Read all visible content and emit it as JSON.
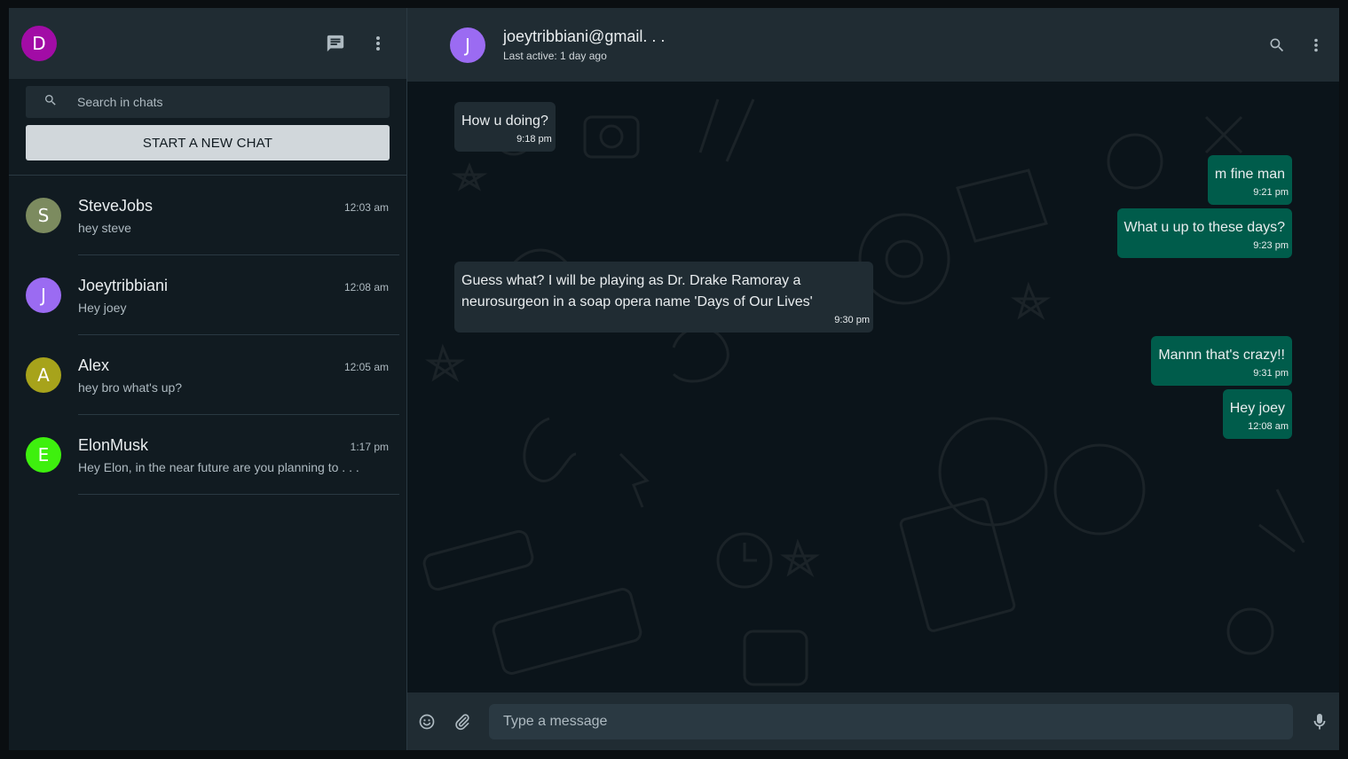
{
  "colors": {
    "accent_outgoing": "#005c4b",
    "incoming_bubble": "#202c33",
    "panel": "#202c33",
    "background": "#111b21"
  },
  "sidebar": {
    "user_avatar": {
      "initial": "D",
      "color": "#a20ca6"
    },
    "icons": [
      "chat-icon",
      "menu-dots-icon"
    ],
    "search": {
      "placeholder": "Search in chats",
      "value": ""
    },
    "new_chat_label": "START A NEW CHAT",
    "chats": [
      {
        "initial": "S",
        "color": "#7c8b5f",
        "name": "SteveJobs",
        "preview": "hey steve",
        "time": "12:03 am"
      },
      {
        "initial": "J",
        "color": "#9b6bf2",
        "name": "Joeytribbiani",
        "preview": "Hey joey",
        "time": "12:08 am"
      },
      {
        "initial": "A",
        "color": "#a7a31b",
        "name": "Alex",
        "preview": "hey bro what's up?",
        "time": "12:05 am"
      },
      {
        "initial": "E",
        "color": "#3ef00e",
        "name": "ElonMusk",
        "preview": "Hey Elon, in the near future are you planning to . . .",
        "time": "1:17 pm"
      }
    ]
  },
  "conversation": {
    "contact": {
      "initial": "J",
      "color": "#9b6bf2",
      "name": "joeytribbiani@gmail. . .",
      "status": "Last active: 1 day ago"
    },
    "icons": [
      "search-icon",
      "menu-dots-icon"
    ],
    "messages": [
      {
        "direction": "in",
        "text": "How u doing?",
        "time": "9:18 pm"
      },
      {
        "direction": "out",
        "text": "m fine man",
        "time": "9:21 pm"
      },
      {
        "direction": "out",
        "text": "What u up to these days?",
        "time": "9:23 pm"
      },
      {
        "direction": "in",
        "text": "Guess what? I will be playing as Dr. Drake Ramoray a neurosurgeon in a soap opera name 'Days of Our Lives'",
        "time": "9:30 pm"
      },
      {
        "direction": "out",
        "text": "Mannn that's crazy!!",
        "time": "9:31 pm"
      },
      {
        "direction": "out",
        "text": "Hey joey",
        "time": "12:08 am"
      }
    ],
    "composer": {
      "placeholder": "Type a message",
      "value": "",
      "icons": [
        "emoji-icon",
        "attach-icon",
        "mic-icon"
      ]
    }
  }
}
